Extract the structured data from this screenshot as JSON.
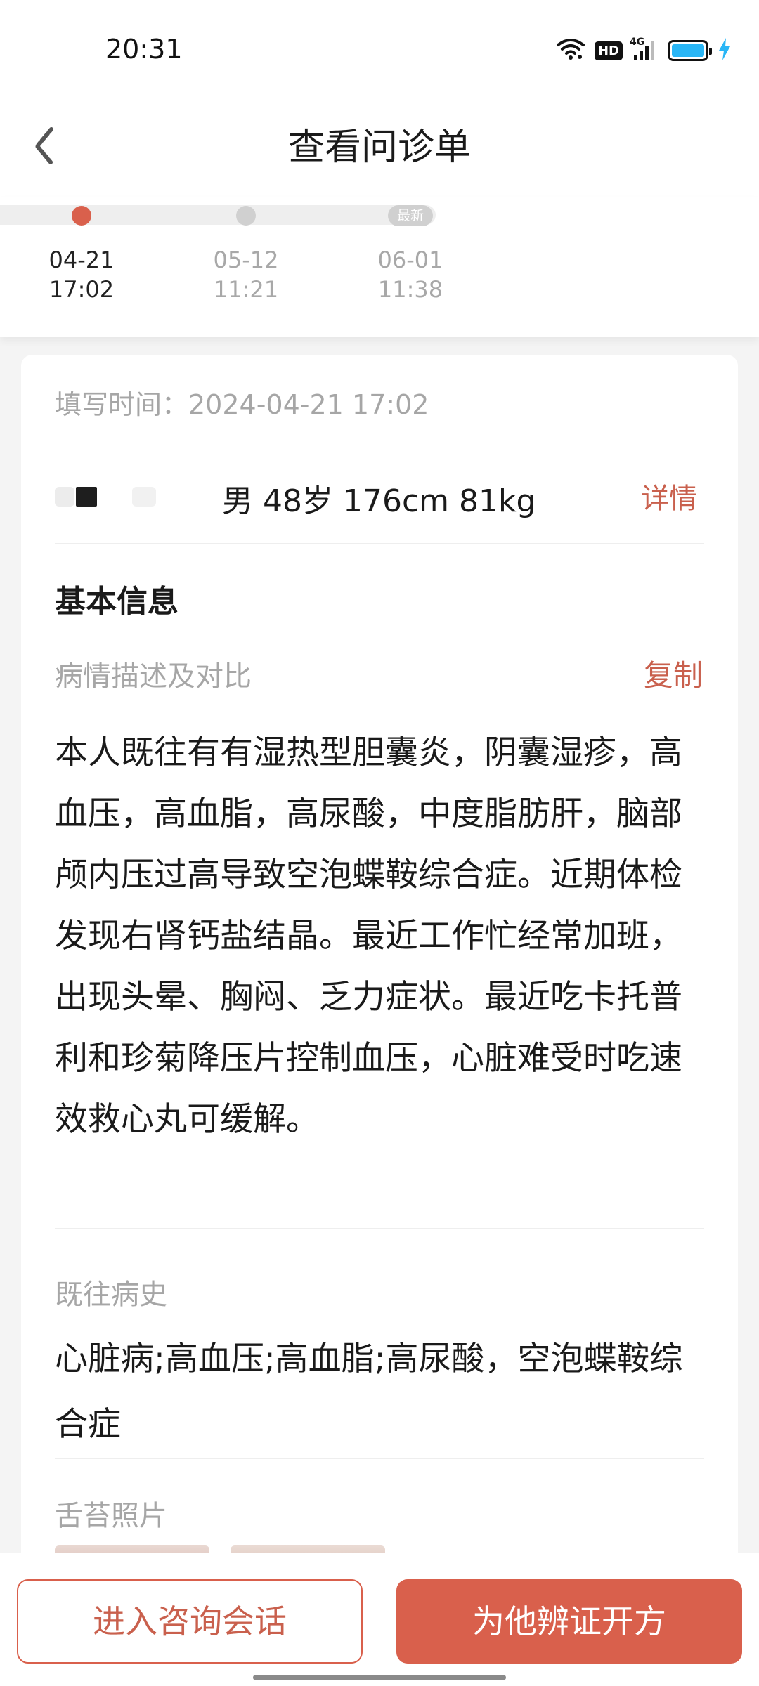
{
  "status_bar": {
    "time": "20:31",
    "hd_label": "HD",
    "network_label": "4G",
    "battery_level": 1.0,
    "icons": [
      "wifi-icon",
      "hd-icon",
      "signal-icon",
      "battery-icon",
      "charging-icon"
    ]
  },
  "header": {
    "title": "查看问诊单",
    "back_icon": "back-arrow-icon"
  },
  "timeline": {
    "items": [
      {
        "date": "04-21",
        "time": "17:02",
        "active": true
      },
      {
        "date": "05-12",
        "time": "11:21",
        "active": false
      },
      {
        "date": "06-01",
        "time": "11:38",
        "active": false,
        "badge": "最新"
      }
    ]
  },
  "record": {
    "fill_time": "填写时间：2024-04-21 17:02",
    "patient_info": "男 48岁 176cm 81kg",
    "detail_link": "详情",
    "section_title": "基本信息",
    "condition_label": "病情描述及对比",
    "copy_link": "复制",
    "condition_text": "本人既往有有湿热型胆囊炎，阴囊湿疹，高血压，高血脂，高尿酸，中度脂肪肝，脑部颅内压过高导致空泡蝶鞍综合症。近期体检发现右肾钙盐结晶。最近工作忙经常加班，出现头晕、胸闷、乏力症状。最近吃卡托普利和珍菊降压片控制血压，心脏难受时吃速效救心丸可缓解。",
    "history_label": "既往病史",
    "history_text": "心脏病;高血压;高血脂;高尿酸，空泡蝶鞍综合症",
    "tongue_label": "舌苔照片"
  },
  "actions": {
    "enter_chat": "进入咨询会话",
    "prescribe": "为他辨证开方"
  },
  "colors": {
    "accent": "#d9604c",
    "link": "#c9604d",
    "muted_text": "#a6a6a6"
  }
}
